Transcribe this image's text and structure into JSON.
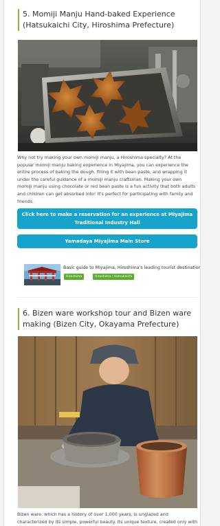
{
  "sections": [
    {
      "title": "5. Momiji Manju Hand-baked Experience (Hatsukaichi City, Hiroshima Prefecture)",
      "description": "Why not try making your own momiji manju, a Hiroshima specialty? At the popular momiji manju baking experience in Miyajima, you can experience the entire process of baking the dough, filling it with bean paste, and wrapping it under the careful guidance of a momiji manju craftsman. Making your own momiji manju using chocolate or red bean paste is a fun activity that both adults and children can get absorbed into! It's perfect for participating with family and friends.",
      "reservation_button": "Click here to make a reservation for an experience at Miyajima Traditional Industry Hall",
      "store_button": "Yamadaya Miyajima Main Store",
      "related": {
        "title": "Basic guide to Miyajima, Hiroshima's leading tourist destination",
        "tags": [
          "Hiroshima",
          "Hiroshima / Hatsukaichi"
        ]
      }
    },
    {
      "title": "6. Bizen ware workshop tour and Bizen ware making (Bizen City, Okayama Prefecture)",
      "description": "Bizen ware, which has a history of over 1,000 years, is unglazed and characterized by its simple, powerful beauty. Its unique texture, created only with clay and fire, has"
    }
  ],
  "colors": {
    "accent": "#8cb43c",
    "button": "#17a4cc",
    "tag": "#5aae2b"
  }
}
